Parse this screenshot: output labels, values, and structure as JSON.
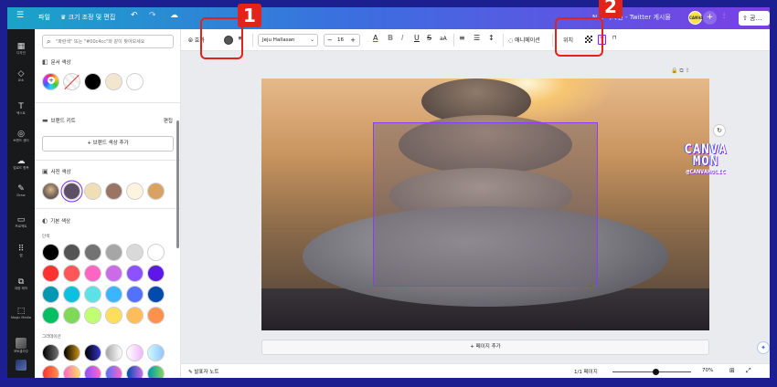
{
  "topbar": {
    "menu_icon": "☰",
    "file": "파일",
    "resize": "♛ 크기 조정 및 편집",
    "undo_icon": "↶",
    "redo_icon": "↷",
    "cloud_icon": "☁",
    "title": "N… 디자인 - Twitter 게시물",
    "avatar": "CANVA",
    "plus": "+",
    "stats_icon": "⫶",
    "share": "⇧ 공…"
  },
  "leftnav": {
    "items": [
      {
        "icon": "▦",
        "label": "디자인"
      },
      {
        "icon": "◇",
        "label": "요소"
      },
      {
        "icon": "T",
        "label": "텍스트"
      },
      {
        "icon": "◎",
        "label": "브랜드 센터"
      },
      {
        "icon": "☁",
        "label": "업로드 항목"
      },
      {
        "icon": "✎",
        "label": "Draw"
      },
      {
        "icon": "▭",
        "label": "프로젝트"
      },
      {
        "icon": "⠿",
        "label": "앱"
      },
      {
        "icon": "⧉",
        "label": "대량 제작"
      },
      {
        "icon": "⬚",
        "label": "Magic Media"
      },
      {
        "icon": "",
        "label": "포토콜라주"
      }
    ]
  },
  "panel": {
    "search_placeholder": "\"파란색\" 또는 \"#00c4cc\"와 같이 찾아보세요",
    "doc_colors_title": "문서 색상",
    "brand_kit_title": "브랜드 키트",
    "brand_edit": "편집",
    "add_brand_color": "+ 브랜드 색상 추가",
    "photo_colors_title": "사진 색상",
    "default_colors_title": "기본 색상",
    "solid_label": "단색",
    "gradient_label": "그라데이션",
    "doc_colors": [
      "#000000",
      "#f2e7cd",
      "#ffffff"
    ],
    "photo_colors": [
      "#5c4f66",
      "#f0dfb4",
      "#9a7563",
      "#fdf3de",
      "#d9a262"
    ],
    "solid_colors": [
      [
        "#000000",
        "#545454",
        "#737373",
        "#a6a6a6",
        "#d9d9d9",
        "#ffffff"
      ],
      [
        "#ff3131",
        "#ff5757",
        "#ff66c4",
        "#cb6ce6",
        "#8c52ff",
        "#5e17eb"
      ],
      [
        "#0097b2",
        "#0cc0df",
        "#5ce1e6",
        "#38b6ff",
        "#5271ff",
        "#004aad"
      ],
      [
        "#00bf63",
        "#7ed957",
        "#c1ff72",
        "#ffde59",
        "#ffbd59",
        "#ff914d"
      ]
    ],
    "gradient_colors": [
      [
        "linear-gradient(90deg,#000,#737373)",
        "linear-gradient(90deg,#000,#c89116)",
        "linear-gradient(90deg,#000,#3533cd)",
        "linear-gradient(90deg,#a6a6a6,#fff)",
        "linear-gradient(90deg,#fff,#f0b6ff)",
        "linear-gradient(90deg,#ccfbff,#93c5fd)"
      ],
      [
        "linear-gradient(90deg,#ff3131,#ff914d)",
        "linear-gradient(90deg,#ff66c4,#ffde59)",
        "linear-gradient(90deg,#8c52ff,#ff66c4)",
        "linear-gradient(90deg,#5170ff,#ff66c4)",
        "linear-gradient(90deg,#004aad,#cb6ce6)",
        "linear-gradient(90deg,#0097b2,#7ed957)"
      ]
    ]
  },
  "toolbar": {
    "effects": "효과",
    "font": "Jeju Hallasan",
    "font_size": "16",
    "minus": "−",
    "plus": "+",
    "text_color": "A",
    "bold": "B",
    "italic": "I",
    "underline": "U",
    "strike": "S",
    "case": "aA",
    "align": "≡",
    "list": "☰",
    "spacing": "↕",
    "animate": "애니메이션",
    "position": "위치",
    "transparency_icon": "checker",
    "text_effect_icon": "T",
    "lock_icon": "🔒"
  },
  "canvas": {
    "page_icons": "🔒 ⧉ ⇪",
    "rotate_icon": "↻",
    "watermark": {
      "line1": "CANVA",
      "line2": "MON",
      "line3": "@CANVAHOLIC"
    },
    "add_page": "+ 페이지 추가",
    "magic_icon": "✦"
  },
  "bottombar": {
    "notes": "발표자 노트",
    "page_count": "1/1 페이지",
    "zoom": "70%",
    "grid_icon": "⊞",
    "fullscreen_icon": "⤢",
    "zoom_fraction": 0.55
  },
  "callouts": {
    "one": "1",
    "two": "2"
  }
}
